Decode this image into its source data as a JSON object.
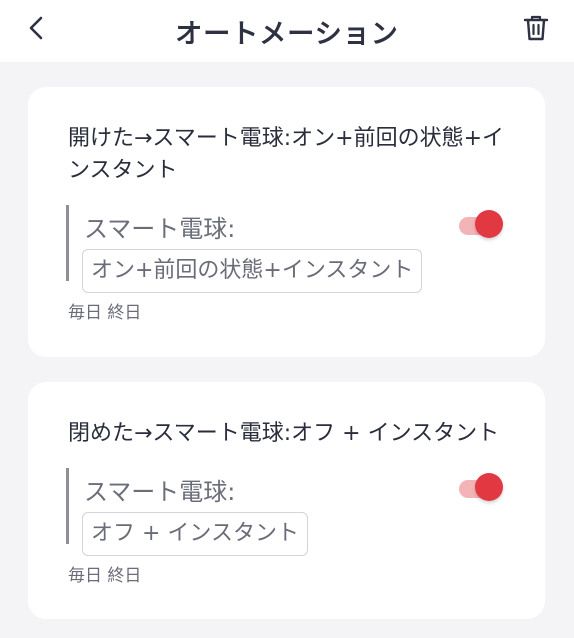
{
  "header": {
    "title": "オートメーション",
    "back_icon": "chevron-left-icon",
    "delete_icon": "trash-icon"
  },
  "automations": [
    {
      "title": "開けた→スマート電球:オン+前回の状態+インスタント",
      "device": "スマート電球:",
      "action": "オン+前回の状態+インスタント",
      "schedule": "毎日 終日",
      "enabled": true
    },
    {
      "title": "閉めた→スマート電球:オフ + インスタント",
      "device": "スマート電球:",
      "action": "オフ + インスタント",
      "schedule": "毎日 終日",
      "enabled": true
    }
  ],
  "colors": {
    "accent": "#e23842",
    "accent_track": "#f2b4b6",
    "background": "#f4f4f6",
    "card": "#ffffff",
    "text": "#2a2e3c"
  }
}
